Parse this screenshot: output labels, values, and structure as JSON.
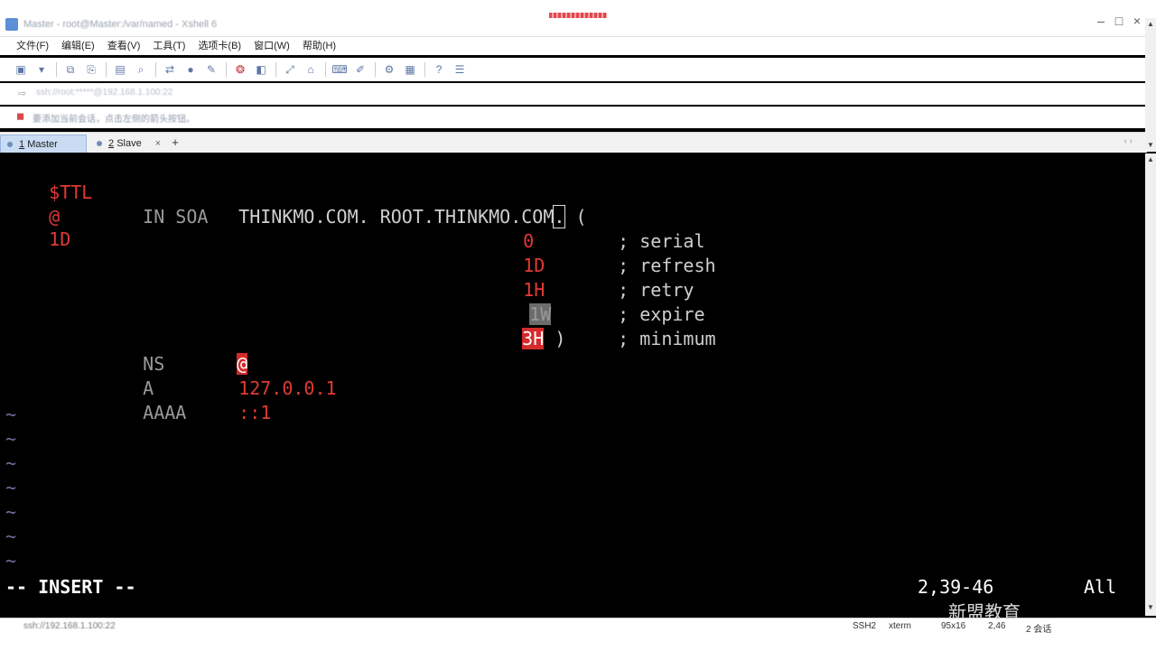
{
  "window": {
    "title": "Master - root@Master:/var/named - Xshell 6"
  },
  "menu": [
    "文件(F)",
    "编辑(E)",
    "查看(V)",
    "工具(T)",
    "选项卡(B)",
    "窗口(W)",
    "帮助(H)"
  ],
  "toolbar": {
    "icons": [
      "new-session-icon",
      "open-icon",
      "copy-icon",
      "paste-icon",
      "properties-icon",
      "find-icon",
      "transfer-icon",
      "globe-icon",
      "script-icon",
      "xftp-icon",
      "xmanager-icon",
      "fullscreen-icon",
      "lock-icon",
      "keyboard-icon",
      "compose-icon",
      "settings-icon",
      "layout-icon",
      "help-icon",
      "chat-icon"
    ]
  },
  "address": {
    "text": "ssh://root:*****@192.168.1.100:22"
  },
  "notice": {
    "text": "要添加当前会话，点击左侧的箭头按钮。"
  },
  "tabs": [
    {
      "num": "1",
      "label": "Master",
      "active": true
    },
    {
      "num": "2",
      "label": "Slave",
      "active": false
    }
  ],
  "editor": {
    "line1": {
      "directive": "$TTL",
      "value": "1D"
    },
    "line2": {
      "at": "@",
      "class": "IN SOA",
      "primary": "THINKMO.COM",
      "cursor": ".",
      "email": "ROOT.THINKMO.COM",
      "paren": "("
    },
    "soa": [
      {
        "value": "0",
        "comment": "; serial"
      },
      {
        "value": "1D",
        "comment": "; refresh"
      },
      {
        "value": "1H",
        "comment": "; retry"
      },
      {
        "value": "1W",
        "comment": "; expire"
      },
      {
        "value": "3H",
        "close": ")",
        "comment": "; minimum"
      }
    ],
    "records": [
      {
        "type": "NS",
        "value": "@"
      },
      {
        "type": "A",
        "value": "127.0.0.1"
      },
      {
        "type": "AAAA",
        "value": "::1"
      }
    ],
    "tilde": "~",
    "mode": "-- INSERT --",
    "position": "2,39-46",
    "scope": "All"
  },
  "status": {
    "connection": "ssh://192.168.1.100:22",
    "protocol": "SSH2",
    "term": "xterm",
    "size": "95x16",
    "cursor": "2,46",
    "sessions": "2 会话"
  },
  "watermark": "新盟教育"
}
